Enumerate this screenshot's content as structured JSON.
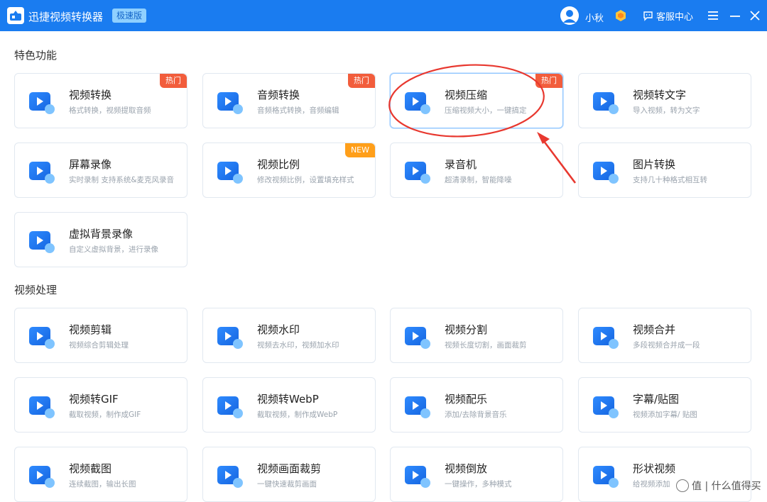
{
  "header": {
    "app_title": "迅捷视频转换器",
    "edition": "极速版",
    "username": "小秋",
    "service_label": "客服中心",
    "bg_color": "#1a7cf0"
  },
  "sections": [
    {
      "title": "特色功能",
      "cards": [
        {
          "name": "视频转换",
          "desc": "格式转换，视频提取音频",
          "badge": "热门",
          "badge_type": "hot",
          "icon": "video-convert-icon"
        },
        {
          "name": "音频转换",
          "desc": "音频格式转换，音频编辑",
          "badge": "热门",
          "badge_type": "hot",
          "icon": "audio-convert-icon"
        },
        {
          "name": "视频压缩",
          "desc": "压缩视频大小，一键搞定",
          "badge": "热门",
          "badge_type": "hot",
          "icon": "video-compress-icon"
        },
        {
          "name": "视频转文字",
          "desc": "导入视频，转为文字",
          "badge": "",
          "badge_type": "",
          "icon": "video-to-text-icon"
        },
        {
          "name": "屏幕录像",
          "desc": "实时录制 支持系统&麦克风录音",
          "badge": "",
          "badge_type": "",
          "icon": "screen-record-icon"
        },
        {
          "name": "视频比例",
          "desc": "修改视频比例，设置填充样式",
          "badge": "NEW",
          "badge_type": "new",
          "icon": "video-ratio-icon"
        },
        {
          "name": "录音机",
          "desc": "超清录制，智能降噪",
          "badge": "",
          "badge_type": "",
          "icon": "recorder-icon"
        },
        {
          "name": "图片转换",
          "desc": "支持几十种格式相互转",
          "badge": "",
          "badge_type": "",
          "icon": "image-convert-icon"
        },
        {
          "name": "虚拟背景录像",
          "desc": "自定义虚拟背景，进行录像",
          "badge": "",
          "badge_type": "",
          "icon": "virtual-bg-icon"
        }
      ]
    },
    {
      "title": "视频处理",
      "cards": [
        {
          "name": "视频剪辑",
          "desc": "视频综合剪辑处理",
          "badge": "",
          "badge_type": "",
          "icon": "video-edit-icon"
        },
        {
          "name": "视频水印",
          "desc": "视频去水印，视频加水印",
          "badge": "",
          "badge_type": "",
          "icon": "video-watermark-icon"
        },
        {
          "name": "视频分割",
          "desc": "视频长度切割，画面裁剪",
          "badge": "",
          "badge_type": "",
          "icon": "video-split-icon"
        },
        {
          "name": "视频合并",
          "desc": "多段视频合并成一段",
          "badge": "",
          "badge_type": "",
          "icon": "video-merge-icon"
        },
        {
          "name": "视频转GIF",
          "desc": "截取视频，制作成GIF",
          "badge": "",
          "badge_type": "",
          "icon": "video-gif-icon"
        },
        {
          "name": "视频转WebP",
          "desc": "截取视频，制作成WebP",
          "badge": "",
          "badge_type": "",
          "icon": "video-webp-icon"
        },
        {
          "name": "视频配乐",
          "desc": "添加/去除背景音乐",
          "badge": "",
          "badge_type": "",
          "icon": "video-music-icon"
        },
        {
          "name": "字幕/贴图",
          "desc": "视频添加字幕/ 贴图",
          "badge": "",
          "badge_type": "",
          "icon": "subtitle-sticker-icon"
        },
        {
          "name": "视频截图",
          "desc": "连续截图，输出长图",
          "badge": "",
          "badge_type": "",
          "icon": "video-screenshot-icon"
        },
        {
          "name": "视频画面裁剪",
          "desc": "一键快速裁剪画面",
          "badge": "",
          "badge_type": "",
          "icon": "video-crop-icon"
        },
        {
          "name": "视频倒放",
          "desc": "一键操作，多种模式",
          "badge": "",
          "badge_type": "",
          "icon": "video-reverse-icon"
        },
        {
          "name": "形状视频",
          "desc": "给视频添加",
          "badge": "",
          "badge_type": "",
          "icon": "shape-video-icon"
        }
      ]
    }
  ],
  "watermark": "值 | 什么值得买"
}
